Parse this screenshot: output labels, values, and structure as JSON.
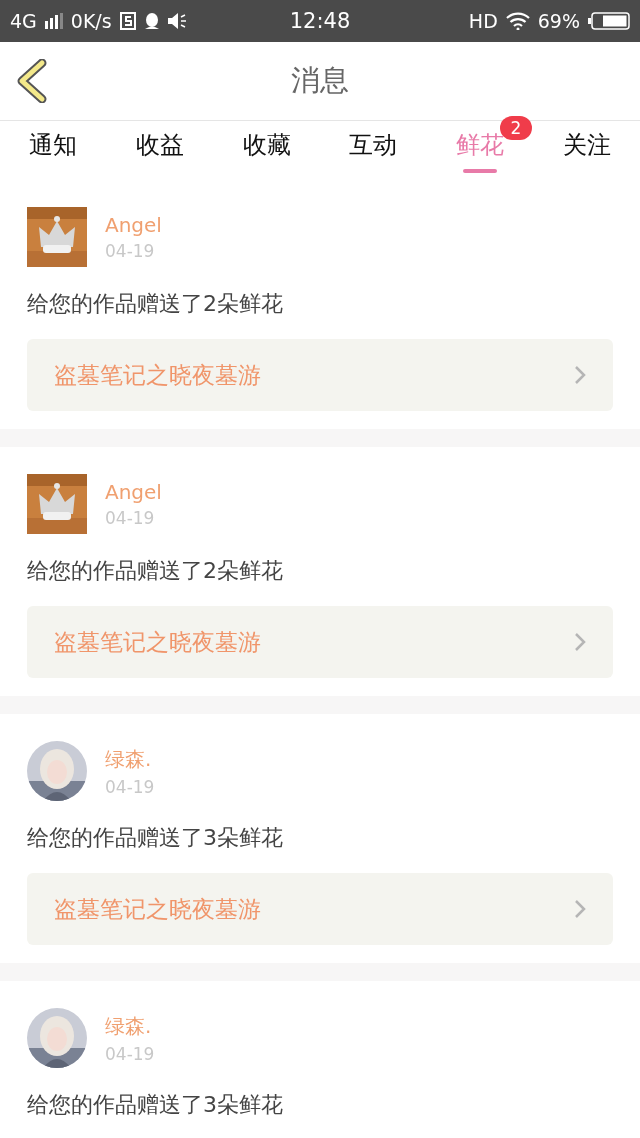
{
  "status_bar": {
    "network": "4G",
    "speed": "0K/s",
    "time": "12:48",
    "hd": "HD",
    "battery": "69%"
  },
  "header": {
    "title": "消息"
  },
  "tabs": [
    {
      "label": "通知",
      "selected": false
    },
    {
      "label": "收益",
      "selected": false
    },
    {
      "label": "收藏",
      "selected": false
    },
    {
      "label": "互动",
      "selected": false
    },
    {
      "label": "鲜花",
      "selected": true,
      "badge": "2"
    },
    {
      "label": "关注",
      "selected": false
    }
  ],
  "messages": [
    {
      "name": "Angel",
      "date": "04-19",
      "kind": "square",
      "text": "给您的作品赠送了2朵鲜花",
      "link": "盗墓笔记之晓夜墓游"
    },
    {
      "name": "Angel",
      "date": "04-19",
      "kind": "square",
      "text": "给您的作品赠送了2朵鲜花",
      "link": "盗墓笔记之晓夜墓游"
    },
    {
      "name": "绿森.",
      "date": "04-19",
      "kind": "round",
      "text": "给您的作品赠送了3朵鲜花",
      "link": "盗墓笔记之晓夜墓游"
    },
    {
      "name": "绿森.",
      "date": "04-19",
      "kind": "round",
      "text": "给您的作品赠送了3朵鲜花"
    }
  ]
}
